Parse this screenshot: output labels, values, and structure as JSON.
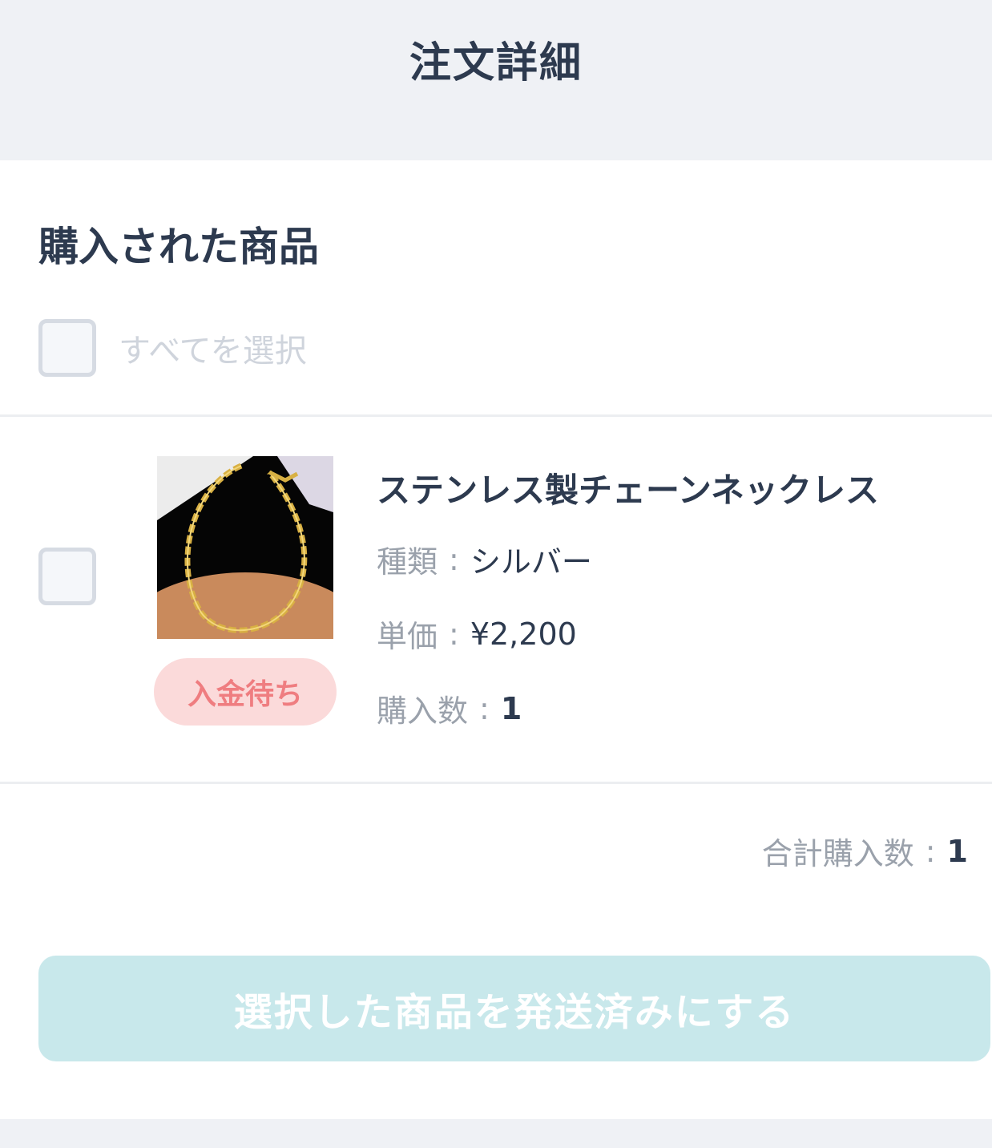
{
  "header": {
    "title": "注文詳細"
  },
  "section": {
    "title": "購入された商品",
    "select_all_label": "すべてを選択"
  },
  "item": {
    "name": "ステンレス製チェーンネックレス",
    "status_badge": "入金待ち",
    "image_icon": "necklace-photo",
    "type_label": "種類",
    "type_value": "シルバー",
    "price_label": "単価",
    "price_value": "¥2,200",
    "quantity_label": "購入数",
    "quantity_value": "1",
    "separator": ":"
  },
  "summary": {
    "total_label": "合計購入数",
    "total_value": "1"
  },
  "action": {
    "label": "選択した商品を発送済みにする"
  },
  "colors": {
    "text": "#2d3a4f",
    "muted": "#9aa1ab",
    "badge_bg": "#fbdada",
    "badge_text": "#ef7d80",
    "button_bg": "#c8e8eb",
    "page_bg": "#eff1f5"
  }
}
